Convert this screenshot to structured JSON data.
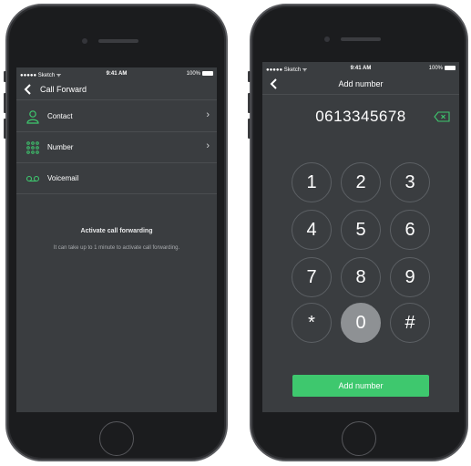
{
  "left_phone": {
    "status_bar": {
      "carrier": "●●●●● Sketch ᯤ",
      "time": "9:41 AM",
      "battery": "100%"
    },
    "nav": {
      "back_icon": "chevron-left-icon",
      "title": "Call Forward"
    },
    "rows": [
      {
        "label": "Contact",
        "icon": "person-icon",
        "chevron": "›"
      },
      {
        "label": "Number",
        "icon": "keypad-icon",
        "chevron": "›"
      },
      {
        "label": "Voicemail",
        "icon": "voicemail-icon"
      }
    ],
    "activate": {
      "title": "Activate call forwarding",
      "description": "It can take up to 1 minute to activate call forwarding."
    }
  },
  "right_phone": {
    "status_bar": {
      "carrier": "●●●●● Sketch ᯤ",
      "time": "9:41 AM",
      "battery": "100%"
    },
    "nav": {
      "back_icon": "chevron-left-icon",
      "title": "Add number"
    },
    "number": "0613345678",
    "keys": [
      "1",
      "2",
      "3",
      "4",
      "5",
      "6",
      "7",
      "8",
      "9",
      "*",
      "0",
      "#"
    ],
    "active_key": "0",
    "add_button": "Add number"
  },
  "colors": {
    "screen_bg": "#3a3d40",
    "accent_green": "#3ec86e",
    "divider": "#4a4d50"
  }
}
